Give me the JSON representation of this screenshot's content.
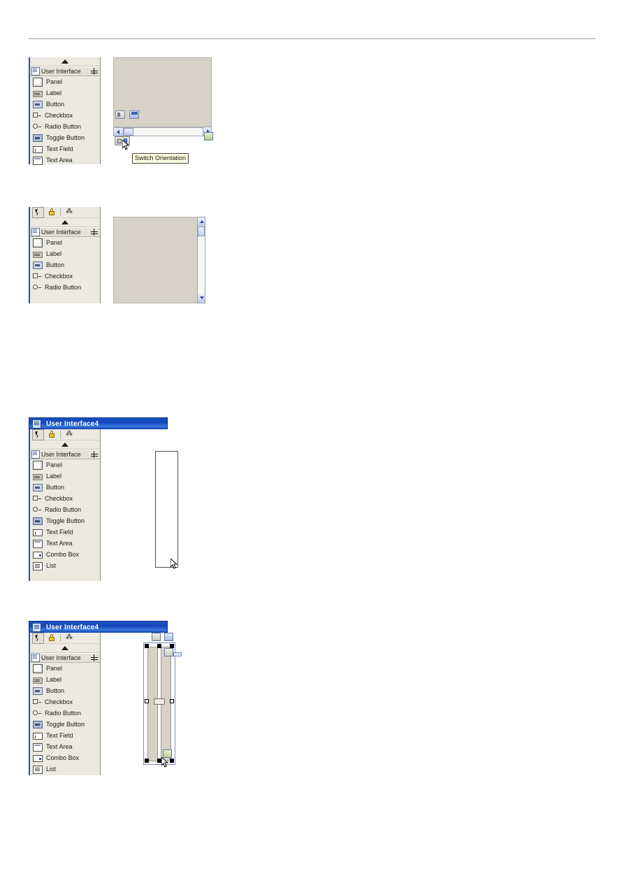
{
  "page": {
    "background": "#ffffff",
    "rule_color": "#9a9a9a"
  },
  "palette": {
    "group_header": "User Interface",
    "group_header_icon": "component-group-icon",
    "move_icon": "move-handle-icon",
    "collapse_icon": "collapse-up-arrow-icon",
    "tools": [
      {
        "name": "selection-arrow-tool",
        "icon": "arrow-cursor-icon",
        "selected": true
      },
      {
        "name": "lock-tool",
        "icon": "padlock-icon",
        "selected": false
      },
      {
        "name": "magic-wand-tool",
        "icon": "wand-icon",
        "selected": false
      }
    ],
    "items": [
      {
        "label": "Panel",
        "icon": "panel-icon"
      },
      {
        "label": "Label",
        "icon": "label-icon"
      },
      {
        "label": "Button",
        "icon": "button-icon"
      },
      {
        "label": "Checkbox",
        "icon": "checkbox-icon"
      },
      {
        "label": "Radio Button",
        "icon": "radio-button-icon"
      },
      {
        "label": "Toggle Button",
        "icon": "toggle-button-icon"
      },
      {
        "label": "Text Field",
        "icon": "text-field-icon"
      },
      {
        "label": "Text Area",
        "icon": "text-area-icon"
      },
      {
        "label": "Combo Box",
        "icon": "combo-box-icon"
      },
      {
        "label": "List",
        "icon": "list-icon"
      }
    ],
    "accent_color": "#2c4fb0",
    "background_color": "#ece9e0"
  },
  "figure1": {
    "palette_item_count": 8,
    "canvas_color": "#d6d2c8",
    "toolbar_icons": [
      {
        "name": "split-horizontal-icon"
      },
      {
        "name": "split-vertical-icon"
      }
    ],
    "scrollbar": {
      "orientation": "horizontal",
      "left_arrow": "scroll-left-arrow",
      "right_arrow": "scroll-right-arrow"
    },
    "orientation_button": {
      "name": "switch-orientation-button",
      "icon": "switch-orientation-icon"
    },
    "tooltip": "Switch Orientation"
  },
  "figure2": {
    "palette_item_count": 5,
    "canvas_color": "#d6d2c8",
    "scrollbar": {
      "orientation": "vertical",
      "up_arrow": "scroll-up-arrow",
      "down_arrow": "scroll-down-arrow"
    }
  },
  "figure3": {
    "window_title": "User Interface4",
    "window_icon": "window-form-icon",
    "titlebar_color": "#1346b8",
    "palette_item_count": 10,
    "component": {
      "name": "vertical-split-pane-outline",
      "fill": "#ffffff",
      "border": "#4d4d4d"
    },
    "cursor": "resize-drag-cursor"
  },
  "figure4": {
    "window_title": "User Interface4",
    "window_icon": "window-form-icon",
    "titlebar_color": "#1346b8",
    "palette_item_count": 10,
    "selection": {
      "name": "selected-split-pane",
      "handle_color": "#000000",
      "selection_border": "#7d86c8",
      "pane_color": "#d6d2c8",
      "divider_knob": "split-divider-knob"
    },
    "badges": [
      {
        "name": "split-horizontal-badge"
      },
      {
        "name": "split-vertical-badge"
      },
      {
        "name": "zoom-badge"
      },
      {
        "name": "resize-badge"
      }
    ],
    "cursor": "resize-drag-cursor"
  }
}
